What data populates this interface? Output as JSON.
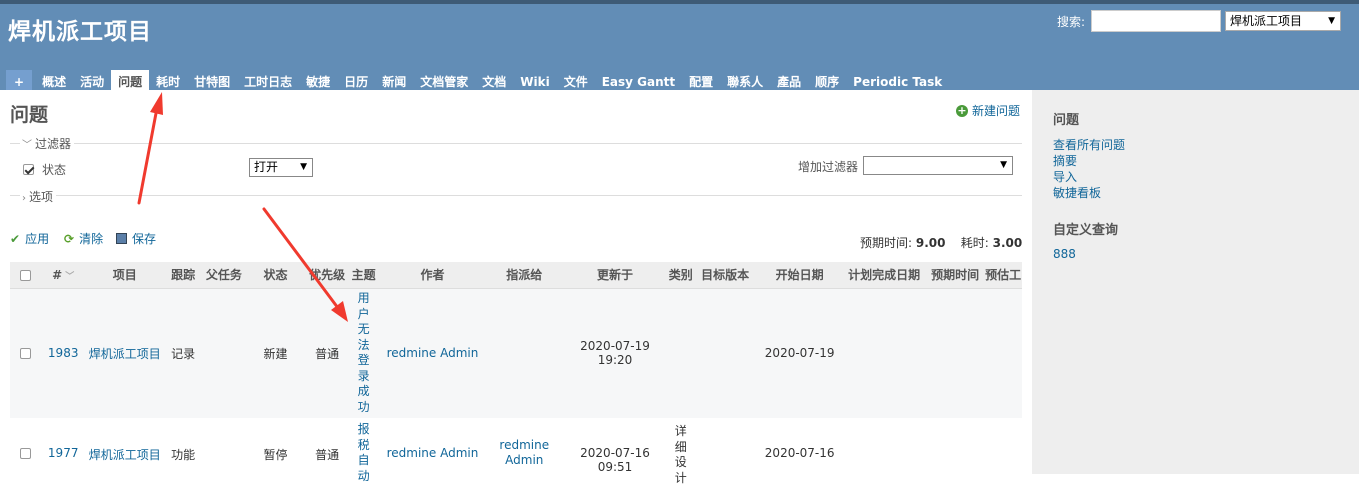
{
  "header": {
    "project_title": "焊机派工项目",
    "search_label": "搜索:",
    "search_value": "",
    "project_jump": "焊机派工项目"
  },
  "menu": [
    {
      "label": "+",
      "name": "menu-new-object"
    },
    {
      "label": "概述",
      "name": "menu-overview"
    },
    {
      "label": "活动",
      "name": "menu-activity"
    },
    {
      "label": "问题",
      "name": "menu-issues",
      "selected": true
    },
    {
      "label": "耗时",
      "name": "menu-time"
    },
    {
      "label": "甘特图",
      "name": "menu-gantt"
    },
    {
      "label": "工时日志",
      "name": "menu-time-log"
    },
    {
      "label": "敏捷",
      "name": "menu-agile"
    },
    {
      "label": "日历",
      "name": "menu-calendar"
    },
    {
      "label": "新闻",
      "name": "menu-news"
    },
    {
      "label": "文档管家",
      "name": "menu-doc-manager"
    },
    {
      "label": "文档",
      "name": "menu-documents"
    },
    {
      "label": "Wiki",
      "name": "menu-wiki"
    },
    {
      "label": "文件",
      "name": "menu-files"
    },
    {
      "label": "Easy Gantt",
      "name": "menu-easy-gantt"
    },
    {
      "label": "配置",
      "name": "menu-settings"
    },
    {
      "label": "聯系人",
      "name": "menu-contacts"
    },
    {
      "label": "產品",
      "name": "menu-products"
    },
    {
      "label": "顺序",
      "name": "menu-order"
    },
    {
      "label": "Periodic Task",
      "name": "menu-periodic-task"
    }
  ],
  "main": {
    "heading": "问题",
    "new_issue": "新建问题",
    "filters_legend": "过滤器",
    "status_label": "状态",
    "status_operator": "打开",
    "add_filter_label": "增加过滤器",
    "add_filter_value": "",
    "options_legend": "选项",
    "apply": "应用",
    "clear": "清除",
    "save": "保存",
    "totals": {
      "estimated_label": "预期时间:",
      "estimated_value": "9.00",
      "spent_label": "耗时:",
      "spent_value": "3.00"
    }
  },
  "table": {
    "columns": [
      "#",
      "项目",
      "跟踪",
      "父任务",
      "状态",
      "优先级",
      "主题",
      "作者",
      "指派给",
      "更新于",
      "类别",
      "目标版本",
      "开始日期",
      "计划完成日期",
      "预期时间",
      "预估工"
    ],
    "rows": [
      {
        "id": "1983",
        "project": "焊机派工项目",
        "tracker": "记录",
        "parent": "",
        "status": "新建",
        "priority": "普通",
        "subject": "用户无法登录成功",
        "author": "redmine Admin",
        "assignee": "",
        "updated": "2020-07-19 19:20",
        "category": "",
        "version": "",
        "start": "2020-07-19",
        "due": "",
        "estimated": "",
        "estimated2": ""
      },
      {
        "id": "1977",
        "project": "焊机派工项目",
        "tracker": "功能",
        "parent": "",
        "status": "暂停",
        "priority": "普通",
        "subject": "报税自动",
        "author": "redmine Admin",
        "assignee": "redmine Admin",
        "updated": "2020-07-16 09:51",
        "category": "详细设计",
        "version": "",
        "start": "2020-07-16",
        "due": "",
        "estimated": "",
        "estimated2": ""
      }
    ]
  },
  "sidebar": {
    "issues_title": "问题",
    "links": [
      "查看所有问题",
      "摘要",
      "导入",
      "敏捷看板"
    ],
    "queries_title": "自定义查询",
    "queries": [
      "888"
    ]
  },
  "colors": {
    "header_bg": "#628db6",
    "link": "#169",
    "annotation_arrow": "#f03a2e"
  }
}
